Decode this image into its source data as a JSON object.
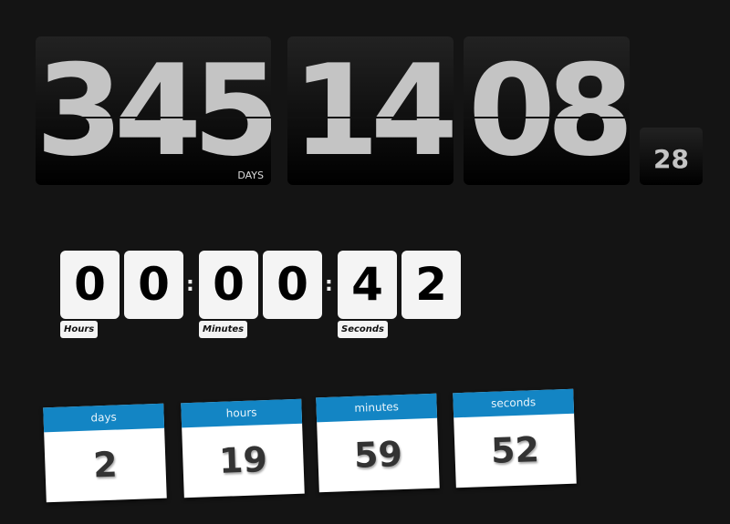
{
  "flip_clock": {
    "days": "345",
    "days_label": "DAYS",
    "hours": "14",
    "minutes": "08",
    "seconds": "28"
  },
  "tile_clock": {
    "digits": [
      "0",
      "0",
      "0",
      "0",
      "4",
      "2"
    ],
    "separator": ":",
    "labels": {
      "hours": "Hours",
      "minutes": "Minutes",
      "seconds": "Seconds"
    }
  },
  "card_clock": [
    {
      "label": "days",
      "value": "2"
    },
    {
      "label": "hours",
      "value": "19"
    },
    {
      "label": "minutes",
      "value": "59"
    },
    {
      "label": "seconds",
      "value": "52"
    }
  ],
  "colors": {
    "background": "#141414",
    "card_header": "#1385c4",
    "flip_digit": "#c4c4c4"
  }
}
